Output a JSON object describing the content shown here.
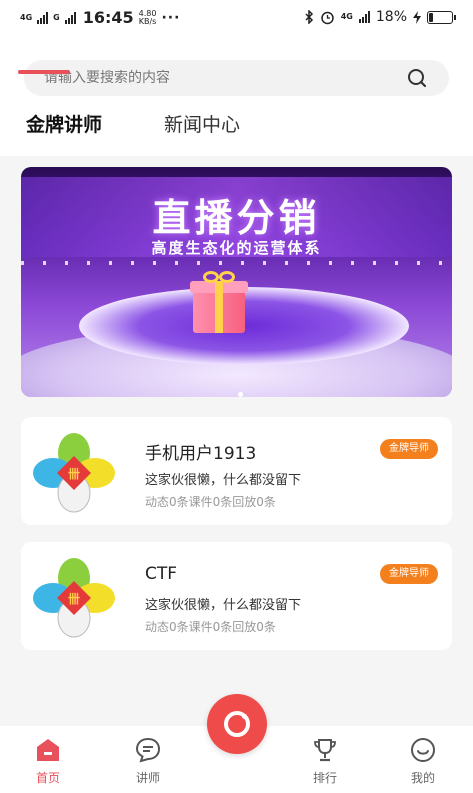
{
  "status_bar": {
    "network_left": "4G",
    "network_right": "G",
    "time": "16:45",
    "speed_value": "4.80",
    "speed_unit": "KB/s",
    "dots": "···",
    "network_2": "4G",
    "battery_percent": "18%",
    "battery_level": 0.18
  },
  "search": {
    "placeholder": "请输入要搜索的内容",
    "icon": "search-icon"
  },
  "tabs": [
    {
      "label": "金牌讲师",
      "active": true
    },
    {
      "label": "新闻中心",
      "active": false
    }
  ],
  "banner": {
    "title": "直播分销",
    "subtitle": "高度生态化的运营体系"
  },
  "lecturers": [
    {
      "name": "手机用户1913",
      "badge": "金牌导师",
      "bio": "这家伙很懒，什么都没留下",
      "stats": "动态0条课件0条回放0条"
    },
    {
      "name": "CTF",
      "badge": "金牌导师",
      "bio": "这家伙很懒，什么都没留下",
      "stats": "动态0条课件0条回放0条"
    }
  ],
  "bottom_nav": [
    {
      "label": "首页",
      "icon": "home-icon",
      "active": true
    },
    {
      "label": "讲师",
      "icon": "chat-icon",
      "active": false
    },
    {
      "label": "排行",
      "icon": "trophy-icon",
      "active": false
    },
    {
      "label": "我的",
      "icon": "smile-icon",
      "active": false
    }
  ],
  "colors": {
    "accent": "#e8505b",
    "badge": "#f3801c",
    "fab": "#f04b4b"
  }
}
